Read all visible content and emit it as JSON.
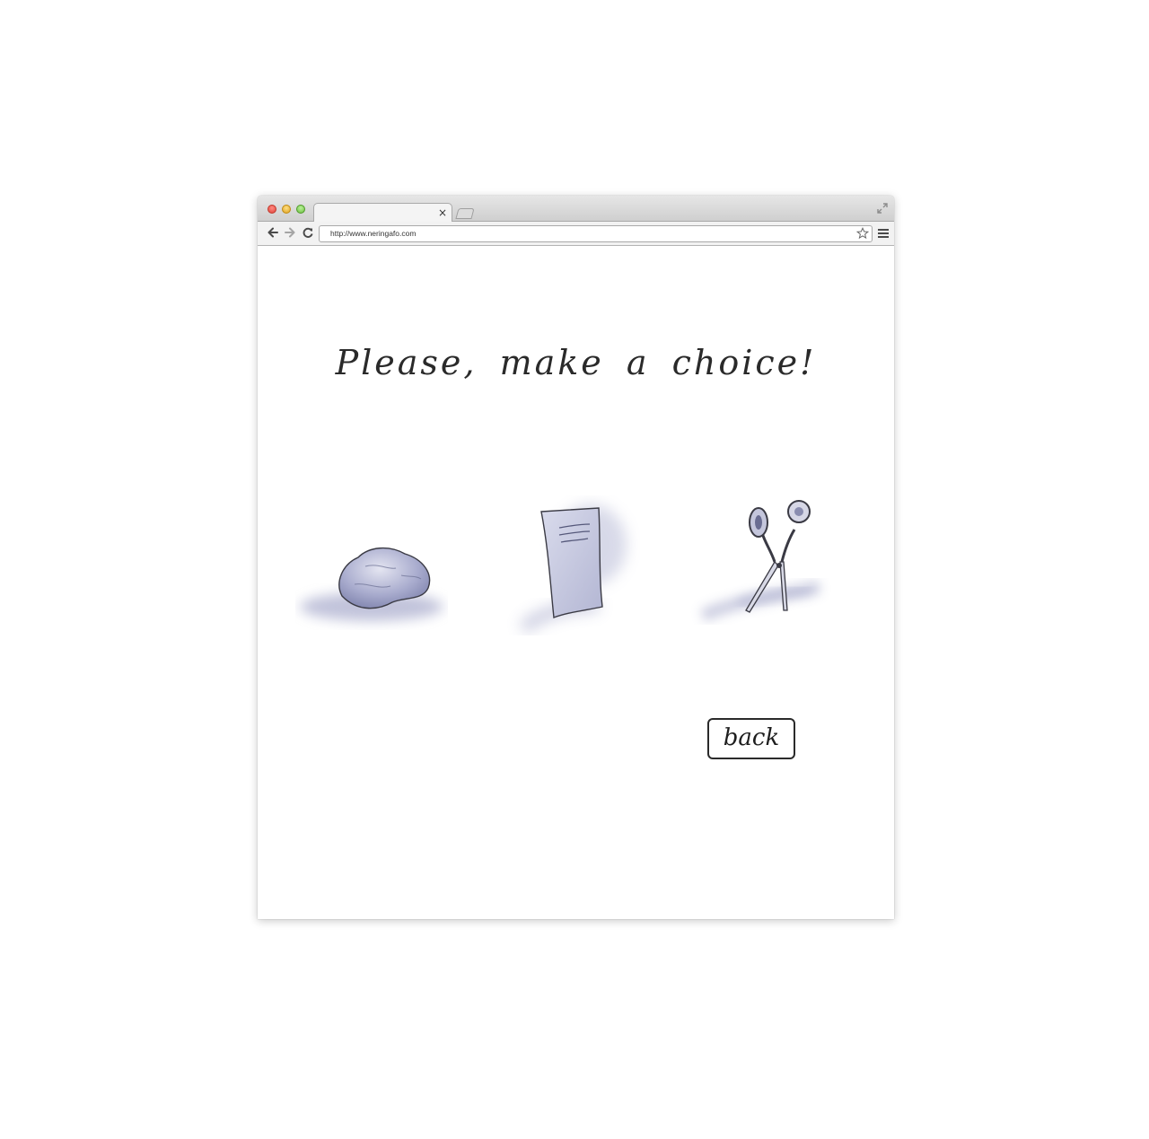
{
  "browser": {
    "url": "http://www.neringafo.com",
    "tab_close_glyph": "×"
  },
  "page": {
    "heading": "Please, make a choice!",
    "choices": [
      {
        "name": "rock",
        "icon": "rock-icon"
      },
      {
        "name": "paper",
        "icon": "paper-icon"
      },
      {
        "name": "scissors",
        "icon": "scissors-icon"
      }
    ],
    "back_label": "back"
  },
  "colors": {
    "ink": "#2a2a2a",
    "shade": "#8f93bd"
  }
}
